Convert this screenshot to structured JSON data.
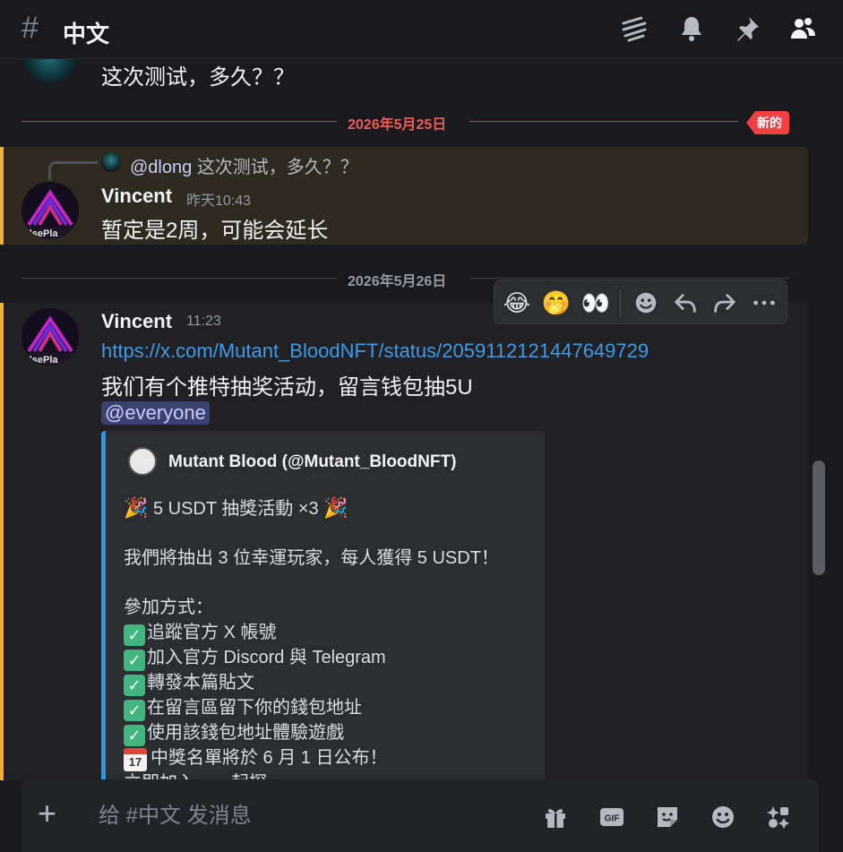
{
  "header": {
    "channel_name": "中文",
    "icons": [
      "threads-icon",
      "bell-icon",
      "pin-icon",
      "members-icon"
    ]
  },
  "previous_message": {
    "text": "这次测试，多久？？"
  },
  "divider1": {
    "date": "2026年5月25日",
    "badge": "新的"
  },
  "message1": {
    "reply_author": "@dlong",
    "reply_text": "这次测试，多久？？",
    "author": "Vincent",
    "timestamp": "昨天10:43",
    "text": "暂定是2周，可能会延长"
  },
  "divider2": {
    "date": "2026年5月26日"
  },
  "toolbar": {
    "reactions": [
      "😂",
      "🤭",
      "👀"
    ],
    "icons": [
      "add-reaction-icon",
      "reply-icon",
      "forward-icon",
      "more-icon"
    ]
  },
  "message2": {
    "author": "Vincent",
    "timestamp": "11:23",
    "link": "https://x.com/Mutant_BloodNFT/status/2059112121447649729",
    "text": "我们有个推特抽奖活动，留言钱包抽5U",
    "mention": "@everyone"
  },
  "embed": {
    "author": "Mutant Blood (@Mutant_BloodNFT)",
    "title_line": "5 USDT 抽獎活動 ×3",
    "intro": "我們將抽出 3 位幸運玩家，每人獲得 5 USDT！",
    "how_to": "參加方式：",
    "steps": [
      "追蹤官方 X 帳號",
      "加入官方 Discord 與 Telegram",
      "轉發本篇貼文",
      "在留言區留下你的錢包地址",
      "使用該錢包地址體驗遊戲"
    ],
    "announce": "中獎名單將於 6 月 1 日公布！",
    "cal_label": "17",
    "cut_off": "立即加入，一起探"
  },
  "composer": {
    "placeholder": "给 #中文 发消息",
    "icons": [
      "gift-icon",
      "gif-icon",
      "sticker-icon",
      "emoji-icon",
      "apps-icon"
    ],
    "gif_label": "GIF"
  },
  "colors": {
    "accent_new": "#f23f43",
    "highlight_bar": "#f0b232",
    "link": "#3f9be8",
    "embed_bar": "#1d9bf0"
  }
}
